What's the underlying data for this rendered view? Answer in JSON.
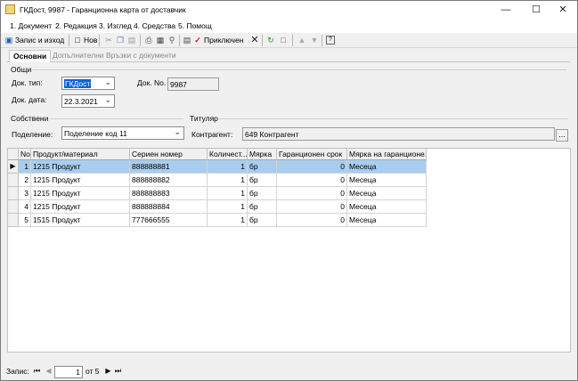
{
  "window": {
    "title": "ГКДост, 9987 - Гаранционна карта от доставчик"
  },
  "menu": [
    {
      "label": "1. Документ"
    },
    {
      "label": "2. Редакция"
    },
    {
      "label": "3. Изглед"
    },
    {
      "label": "4. Средства"
    },
    {
      "label": "5. Помощ"
    }
  ],
  "toolbar": {
    "save_exit": "Запис и изход",
    "new": "Нов",
    "close": "Приключен"
  },
  "tabs": [
    {
      "label": "Основни"
    },
    {
      "label": "Допълнителни"
    },
    {
      "label": "Връзки с документи"
    }
  ],
  "general": {
    "group": "Общи",
    "doc_type_label": "Док. тип:",
    "doc_type_value": "ГКДост",
    "doc_no_label": "Док. No.",
    "doc_no_value": "9987",
    "doc_date_label": "Док. дата:",
    "doc_date_value": "22.3.2021"
  },
  "owners": {
    "group": "Собствени",
    "division_label": "Поделение:",
    "division_value": "Поделение код 11"
  },
  "holder": {
    "group": "Титуляр",
    "contractor_label": "Контрагент:",
    "contractor_value": "649 Контрагент",
    "browse": "..."
  },
  "grid": {
    "columns": [
      "No.",
      "Продукт/материал",
      "Сериен номер",
      "Количест...",
      "Мярка",
      "Гаранционен срок",
      "Мярка на гаранционе..."
    ],
    "rows": [
      {
        "no": "1",
        "product": "1215 Продукт",
        "serial": "888888881",
        "qty": "1",
        "unit": "бр",
        "warranty": "0",
        "warranty_unit": "Месеца"
      },
      {
        "no": "2",
        "product": "1215 Продукт",
        "serial": "888888882",
        "qty": "1",
        "unit": "бр",
        "warranty": "0",
        "warranty_unit": "Месеца"
      },
      {
        "no": "3",
        "product": "1215 Продукт",
        "serial": "888888883",
        "qty": "1",
        "unit": "бр",
        "warranty": "0",
        "warranty_unit": "Месеца"
      },
      {
        "no": "4",
        "product": "1215 Продукт",
        "serial": "888888884",
        "qty": "1",
        "unit": "бр",
        "warranty": "0",
        "warranty_unit": "Месеца"
      },
      {
        "no": "5",
        "product": "1515 Продукт",
        "serial": "777666555",
        "qty": "1",
        "unit": "бр",
        "warranty": "0",
        "warranty_unit": "Месеца"
      }
    ]
  },
  "status": {
    "record_label": "Запис:",
    "current": "1",
    "of_label": "от 5"
  }
}
